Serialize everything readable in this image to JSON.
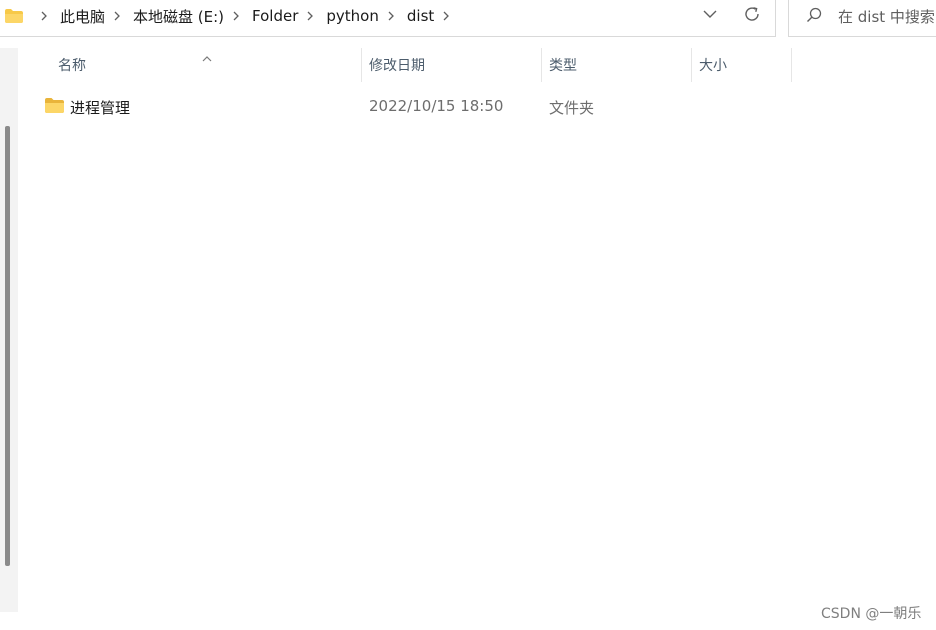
{
  "address_bar": {
    "breadcrumbs": [
      "此电脑",
      "本地磁盘 (E:)",
      "Folder",
      "python",
      "dist"
    ],
    "folder_icon": "folder-icon",
    "dropdown_icon": "chevron-down-icon",
    "refresh_icon": "refresh-icon"
  },
  "search": {
    "placeholder": "在 dist 中搜索",
    "icon": "search-icon"
  },
  "columns": {
    "name": "名称",
    "date_modified": "修改日期",
    "type": "类型",
    "size": "大小",
    "sorted_by": "名称"
  },
  "files": [
    {
      "name": "进程管理",
      "date_modified": "2022/10/15 18:50",
      "type": "文件夹",
      "size": "",
      "icon": "folder-icon"
    }
  ],
  "watermark": "CSDN @一朝乐",
  "colors": {
    "folder_yellow": "#f7c948",
    "header_text": "#4c5c6c",
    "secondary_text": "#6d6d6d"
  }
}
